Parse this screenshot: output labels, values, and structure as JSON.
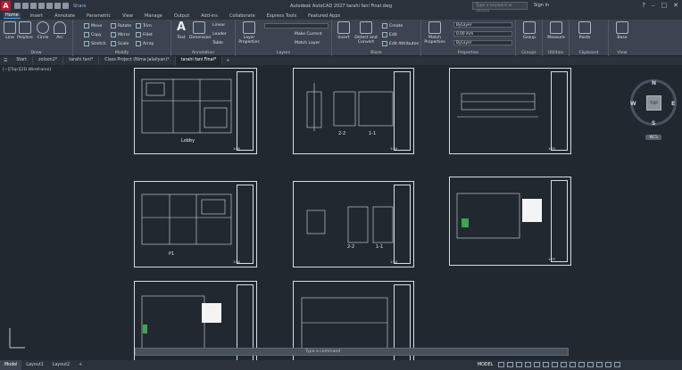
{
  "app": {
    "logo": "A",
    "window_title": "Autodesk AutoCAD 2027    tarahi fani Final.dwg",
    "share": "Share",
    "search_placeholder": "Type a keyword or phrase",
    "sign_in": "Sign In"
  },
  "ribbon_tabs": [
    "Home",
    "Insert",
    "Annotate",
    "Parametric",
    "View",
    "Manage",
    "Output",
    "Add-ins",
    "Collaborate",
    "Express Tools",
    "Featured Apps"
  ],
  "panels": {
    "draw": "Draw",
    "modify": "Modify",
    "annotation": "Annotation",
    "layers": "Layers",
    "block": "Block",
    "properties": "Properties",
    "groups": "Groups",
    "utilities": "Utilities",
    "clipboard": "Clipboard",
    "view": "View"
  },
  "draw_tools": [
    "Line",
    "Polyline",
    "Circle",
    "Arc"
  ],
  "modify_tools": [
    "Move",
    "Rotate",
    "Trim",
    "Copy",
    "Mirror",
    "Fillet",
    "Stretch",
    "Scale",
    "Array"
  ],
  "annotation_tools": {
    "text": "Text",
    "dimension": "Dimension",
    "linear": "Linear",
    "leader": "Leader",
    "table": "Table"
  },
  "layer_tools": {
    "layer_properties": "Layer Properties",
    "make_current": "Make Current",
    "match_layer": "Match Layer"
  },
  "block_tools": {
    "insert": "Insert",
    "create": "Create",
    "edit": "Edit",
    "edit_attributes": "Edit Attributes",
    "detect_convert": "Detect and Convert"
  },
  "properties": {
    "match": "Match Properties",
    "color": "ByLayer",
    "lineweight": "0.00 mm",
    "linetype": "ByLayer"
  },
  "groups_tool": "Group",
  "utilities_tool": "Measure",
  "clipboard_tool": "Paste",
  "view_tool": "Base",
  "doc_tabs": [
    "Start",
    "zoloon2*",
    "tarahi fani*",
    "Class Project (Nima Jalaliyan)*",
    "tarahi fani Final*"
  ],
  "viewport_label": "[−][Top][2D Wireframe]",
  "sheets": [
    {
      "label": "Lobby",
      "scale": "1:80"
    },
    {
      "section_a": "2-2",
      "section_b": "1-1",
      "scale": "1:50"
    },
    {
      "scale": "1:75"
    },
    {
      "label": "P1",
      "scale": "1:80"
    },
    {
      "section_a": "2-2",
      "section_b": "1-1",
      "scale": "1:50"
    },
    {
      "scale": "1:75"
    }
  ],
  "viewcube": {
    "top": "TOP",
    "n": "N",
    "s": "S",
    "e": "E",
    "w": "W",
    "wcs": "WCS"
  },
  "command_line": {
    "placeholder": "Type a command"
  },
  "status": {
    "model": "MODEL",
    "layout_tabs": [
      "Model",
      "Layout1",
      "Layout2"
    ]
  }
}
